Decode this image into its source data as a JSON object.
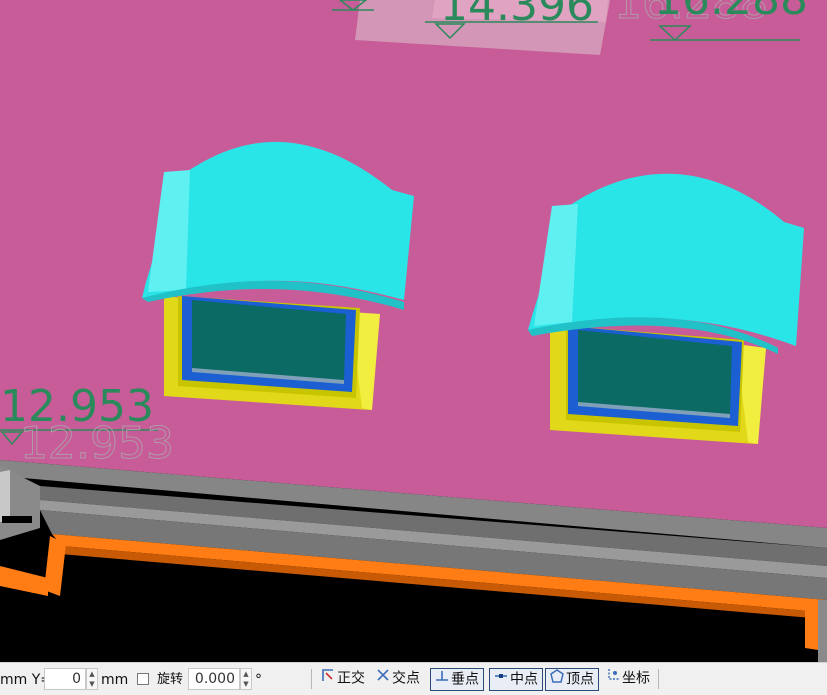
{
  "viewport": {
    "elevation_top_center": "14.396",
    "elevation_top_right": "16.288",
    "elevation_left": "12.953",
    "colors": {
      "wall": "#c85c98",
      "roof_band": "#dcd0d4",
      "dormer_roof": "#29e5e8",
      "window_frame": "#e8e020",
      "window_sash": "#1a63d4",
      "glass": "#0b6a63",
      "ledge": "#7e7e7e",
      "eave_trim": "#ff7d14",
      "background": "#000000",
      "elevation_text": "#2b8a5b"
    }
  },
  "statusbar": {
    "y_label": "mm Y=",
    "y_value": "0",
    "y_unit": "mm",
    "rotate_label": "旋转",
    "rotate_value": "0.000",
    "rotate_unit": "°",
    "snaps": {
      "ortho": "正交",
      "intersection": "交点",
      "perpendicular": "垂点",
      "midpoint": "中点",
      "vertex": "顶点",
      "coordinate": "坐标"
    }
  }
}
